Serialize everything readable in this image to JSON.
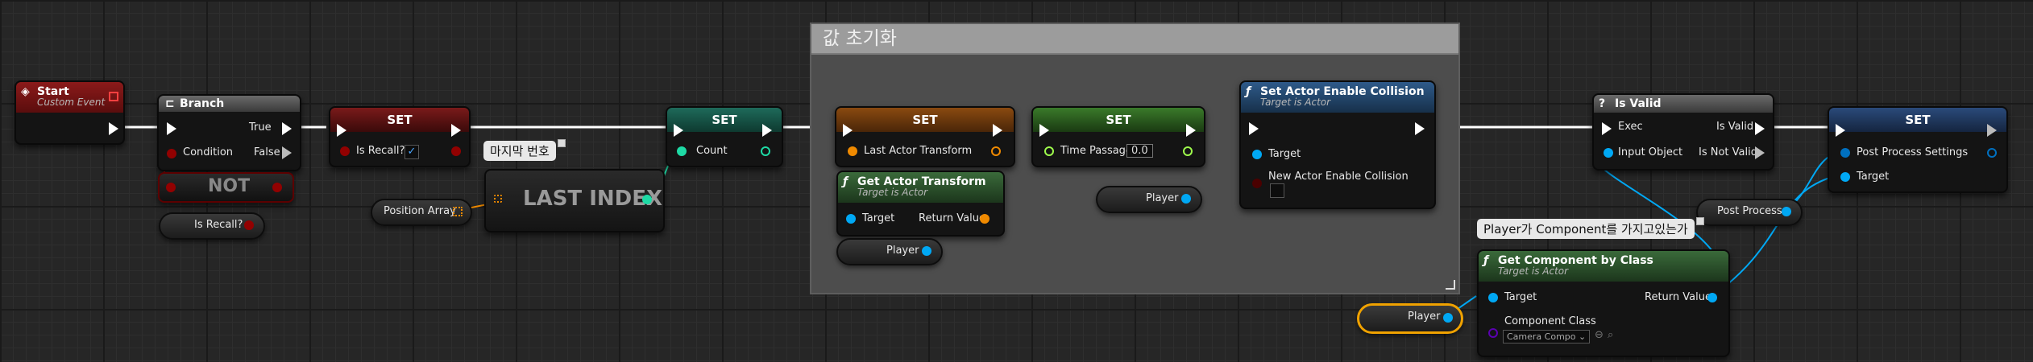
{
  "comment": {
    "title": "값 초기화"
  },
  "nodes": {
    "start": {
      "title": "Start",
      "subtitle": "Custom Event"
    },
    "branch": {
      "title": "Branch",
      "true_label": "True",
      "false_label": "False",
      "condition_label": "Condition"
    },
    "not": {
      "title": "NOT"
    },
    "is_recall_get": {
      "label": "Is Recall?"
    },
    "set_recall": {
      "title": "SET",
      "var_label": "Is Recall?",
      "value": "✓"
    },
    "last_index": {
      "title": "LAST INDEX"
    },
    "last_index_tag": {
      "text": "마지막 번호"
    },
    "position_array": {
      "label": "Position Array"
    },
    "set_count": {
      "title": "SET",
      "var_label": "Count"
    },
    "set_last_actor": {
      "title": "SET",
      "var_label": "Last Actor Transform"
    },
    "get_actor_transform": {
      "title": "Get Actor Transform",
      "subtitle": "Target is Actor",
      "target_label": "Target",
      "return_label": "Return Value"
    },
    "player_1": {
      "label": "Player"
    },
    "set_time": {
      "title": "SET",
      "var_label": "Time Passage",
      "value": "0.0"
    },
    "player_2": {
      "label": "Player"
    },
    "set_collision": {
      "title": "Set Actor Enable Collision",
      "subtitle": "Target is Actor",
      "target_label": "Target",
      "param_label": "New Actor Enable Collision"
    },
    "is_valid": {
      "title": "Is Valid",
      "exec_label": "Exec",
      "valid_label": "Is Valid",
      "not_valid_label": "Is Not Valid",
      "input_label": "Input Object"
    },
    "set_pp": {
      "title": "SET",
      "pp_label": "Post Process Settings",
      "target_label": "Target"
    },
    "post_process": {
      "label": "Post Process"
    },
    "get_component": {
      "title": "Get Component by Class",
      "subtitle": "Target is Actor",
      "target_label": "Target",
      "return_label": "Return Value",
      "class_label": "Component Class",
      "class_value": "Camera Compo"
    },
    "get_component_tag": {
      "text": "Player가 Component를 가지고있는가"
    },
    "player_3": {
      "label": "Player"
    }
  },
  "colors": {
    "exec": "#ffffff",
    "bool": "#920101",
    "object": "#00a8f4",
    "int": "#1edaa5",
    "transform": "#f08a00",
    "float": "#9efb4c",
    "struct": "#0070c0",
    "class": "#5a00b0"
  },
  "icons": {
    "event": "event-diamond-icon",
    "branch": "branch-icon",
    "function": "function-f-icon",
    "valid": "question-icon"
  }
}
